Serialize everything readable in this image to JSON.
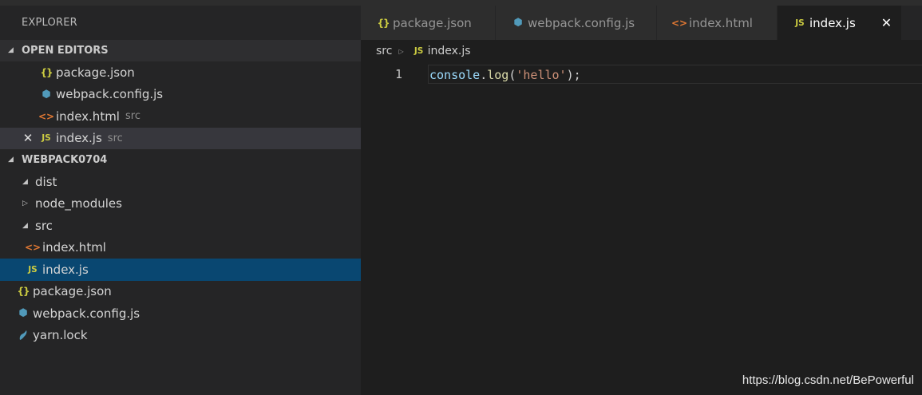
{
  "explorer": {
    "title": "EXPLORER",
    "open_editors": {
      "header": "OPEN EDITORS",
      "items": [
        {
          "name": "package.json",
          "desc": "",
          "icon": "json-icon"
        },
        {
          "name": "webpack.config.js",
          "desc": "",
          "icon": "webpack-icon"
        },
        {
          "name": "index.html",
          "desc": "src",
          "icon": "html-icon"
        },
        {
          "name": "index.js",
          "desc": "src",
          "icon": "js-icon"
        }
      ]
    },
    "workspace": {
      "header": "WEBPACK0704",
      "items": [
        {
          "name": "dist",
          "type": "folder",
          "expanded": true
        },
        {
          "name": "node_modules",
          "type": "folder",
          "expanded": false
        },
        {
          "name": "src",
          "type": "folder",
          "expanded": true
        },
        {
          "name": "index.html",
          "type": "file",
          "icon": "html-icon"
        },
        {
          "name": "index.js",
          "type": "file",
          "icon": "js-icon",
          "selected": true
        },
        {
          "name": "package.json",
          "type": "file",
          "icon": "json-icon"
        },
        {
          "name": "webpack.config.js",
          "type": "file",
          "icon": "webpack-icon"
        },
        {
          "name": "yarn.lock",
          "type": "file",
          "icon": "yarn-icon"
        }
      ]
    }
  },
  "icons": {
    "json": "{}",
    "js": "JS",
    "html": "<>",
    "webpack": "⬢",
    "yarn": "🐈"
  },
  "tabs": [
    {
      "label": "package.json",
      "icon": "json-icon"
    },
    {
      "label": "webpack.config.js",
      "icon": "webpack-icon"
    },
    {
      "label": "index.html",
      "icon": "html-icon"
    },
    {
      "label": "index.js",
      "icon": "js-icon",
      "active": true
    }
  ],
  "breadcrumb": {
    "folder": "src",
    "file": "index.js"
  },
  "code": {
    "line_number": "1",
    "tokens": {
      "obj": "console",
      "dot": ".",
      "func": "log",
      "open": "(",
      "str": "'hello'",
      "close": ");"
    }
  },
  "watermark": "https://blog.csdn.net/BePowerful",
  "colors": {
    "selection": "#094771",
    "js_icon": "#cbcb41",
    "html_icon": "#e37933",
    "webpack_icon": "#519aba"
  }
}
